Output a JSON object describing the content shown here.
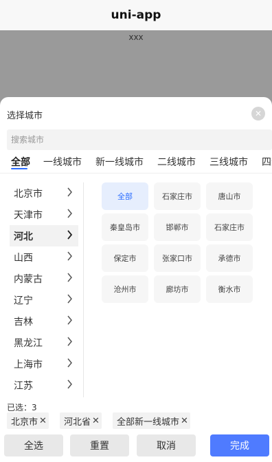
{
  "navbar": {
    "title": "uni-app"
  },
  "background": {
    "text": "xxx"
  },
  "sheet": {
    "title": "选择城市",
    "search_placeholder": "搜索城市",
    "tabs": [
      "全部",
      "一线城市",
      "新一线城市",
      "二线城市",
      "三线城市",
      "四线"
    ],
    "active_tab": 0,
    "provinces": [
      "北京市",
      "天津市",
      "河北",
      "山西",
      "内蒙古",
      "辽宁",
      "吉林",
      "黑龙江",
      "上海市",
      "江苏"
    ],
    "active_province": 2,
    "cities": [
      "全部",
      "石家庄市",
      "唐山市",
      "秦皇岛市",
      "邯郸市",
      "石家庄市",
      "保定市",
      "张家口市",
      "承德市",
      "沧州市",
      "廊坊市",
      "衡水市"
    ],
    "active_city": 0,
    "selected_label": "已选：3",
    "selected_chips": [
      "北京市",
      "河北省",
      "全部新一线城市"
    ],
    "buttons": {
      "select_all": "全选",
      "reset": "重置",
      "cancel": "取消",
      "done": "完成"
    }
  },
  "colors": {
    "accent": "#4f7bff",
    "active_city_bg": "#e6eefd",
    "overlay": "#9a9a9a"
  }
}
